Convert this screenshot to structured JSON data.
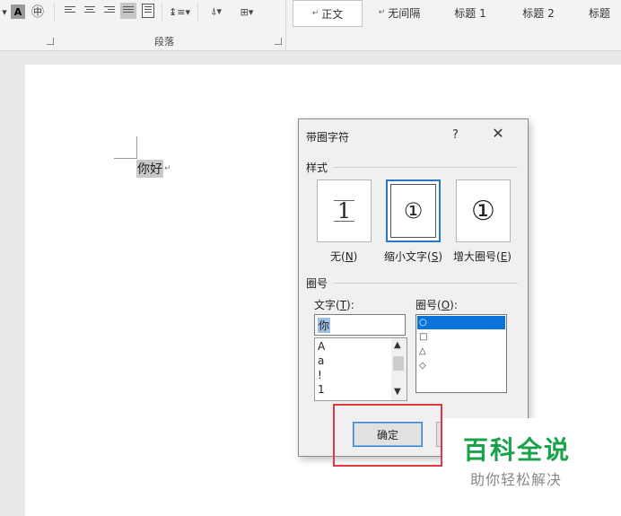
{
  "ribbon": {
    "paragraph_group_label": "段落",
    "styles": [
      "正文",
      "无间隔",
      "标题 1",
      "标题 2",
      "标题"
    ],
    "font_color_letter": "A",
    "encircle_glyph": "㊥"
  },
  "document": {
    "text": "你好",
    "paragraph_mark": "↵"
  },
  "dialog": {
    "title": "带圈字符",
    "help": "?",
    "close": "✕",
    "style_section": "样式",
    "style_options": [
      {
        "preview": "1",
        "label_prefix": "无(",
        "key": "N",
        "label_suffix": ")"
      },
      {
        "preview": "①",
        "label_prefix": "缩小文字(",
        "key": "S",
        "label_suffix": ")"
      },
      {
        "preview": "①",
        "label_prefix": "增大圈号(",
        "key": "E",
        "label_suffix": ")"
      }
    ],
    "encircle_section": "圈号",
    "text_label": {
      "prefix": "文字(",
      "key": "T",
      "suffix": "):"
    },
    "text_value": "你",
    "text_list": [
      "A",
      "a",
      "!",
      "1"
    ],
    "enclosure_label": {
      "prefix": "圈号(",
      "key": "O",
      "suffix": "):"
    },
    "enclosure_list": [
      "○",
      "□",
      "△",
      "◇"
    ],
    "ok": "确定"
  },
  "watermark": {
    "title": "百科全说",
    "subtitle": "助你轻松解决"
  },
  "colors": {
    "selection_blue": "#0a74da",
    "highlight_red": "#e0393e",
    "watermark_green": "#1aa24a"
  }
}
